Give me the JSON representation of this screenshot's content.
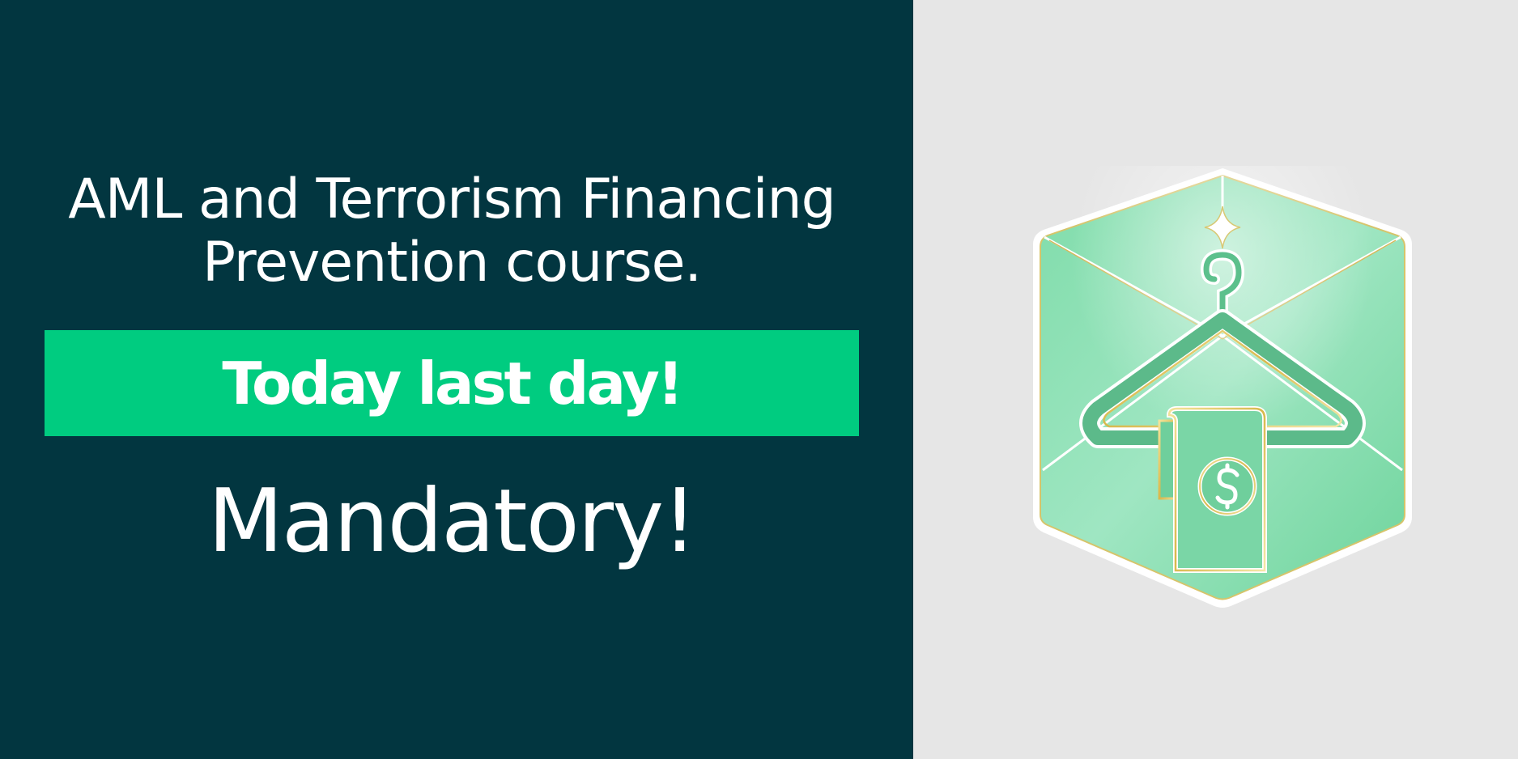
{
  "banner": {
    "title_line1": "AML and Terrorism Financing",
    "title_line2": "Prevention course.",
    "highlight": "Today last day!",
    "mandatory": "Mandatory!"
  },
  "badge": {
    "icon": "money-hanger-icon"
  },
  "colors": {
    "left_bg": "#023640",
    "right_bg": "#e6e6e6",
    "accent": "#00cc80",
    "text": "#ffffff"
  }
}
